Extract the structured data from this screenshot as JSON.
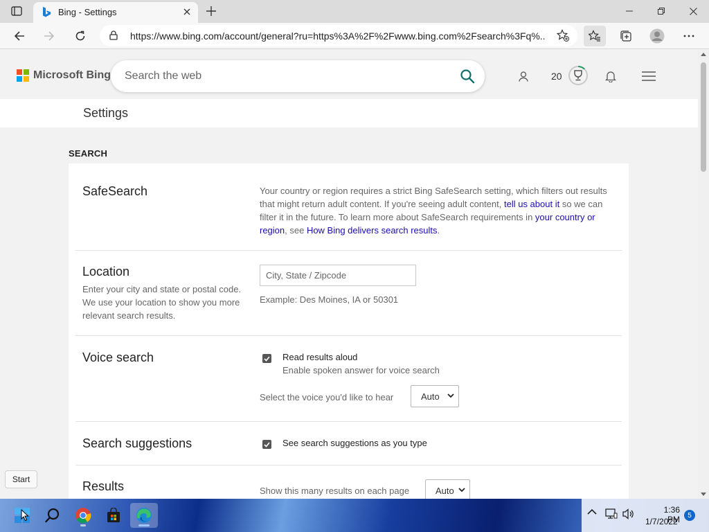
{
  "browser": {
    "tab_title": "Bing - Settings",
    "url": "https://www.bing.com/account/general?ru=https%3A%2F%2Fwww.bing.com%2Fsearch%3Fq%..."
  },
  "header": {
    "logo_text": "Microsoft Bing",
    "search_placeholder": "Search the web",
    "rewards_count": "20"
  },
  "page": {
    "title": "Settings",
    "section_label": "SEARCH"
  },
  "safesearch": {
    "title": "SafeSearch",
    "text_1": "Your country or region requires a strict Bing SafeSearch setting, which filters out results that might return adult content. If you're seeing adult content, ",
    "link_1": "tell us about it",
    "text_2": " so we can filter it in the future. To learn more about SafeSearch requirements in ",
    "link_2": "your country or region",
    "text_3": ", see ",
    "link_3": "How Bing delivers search results",
    "text_4": "."
  },
  "location": {
    "title": "Location",
    "description": "Enter your city and state or postal code. We use your location to show you more relevant search results.",
    "placeholder": "City, State / Zipcode",
    "example": "Example: Des Moines, IA or 50301"
  },
  "voice_search": {
    "title": "Voice search",
    "checkbox_label": "Read results aloud",
    "checkbox_sub": "Enable spoken answer for voice search",
    "checked": true,
    "voice_label": "Select the voice you'd like to hear",
    "voice_value": "Auto"
  },
  "suggestions": {
    "title": "Search suggestions",
    "checkbox_label": "See search suggestions as you type",
    "checked": true
  },
  "results": {
    "title": "Results",
    "label": "Show this many results on each page",
    "value": "Auto"
  },
  "tooltip": {
    "start": "Start"
  },
  "taskbar": {
    "time": "1:36 PM",
    "date": "1/7/2022",
    "notifications": "5"
  },
  "colors": {
    "ms_red": "#f25022",
    "ms_green": "#7fba00",
    "ms_blue": "#00a4ef",
    "ms_yellow": "#ffb900",
    "bing_teal": "#0f6e6e",
    "link": "#1a0dab"
  }
}
